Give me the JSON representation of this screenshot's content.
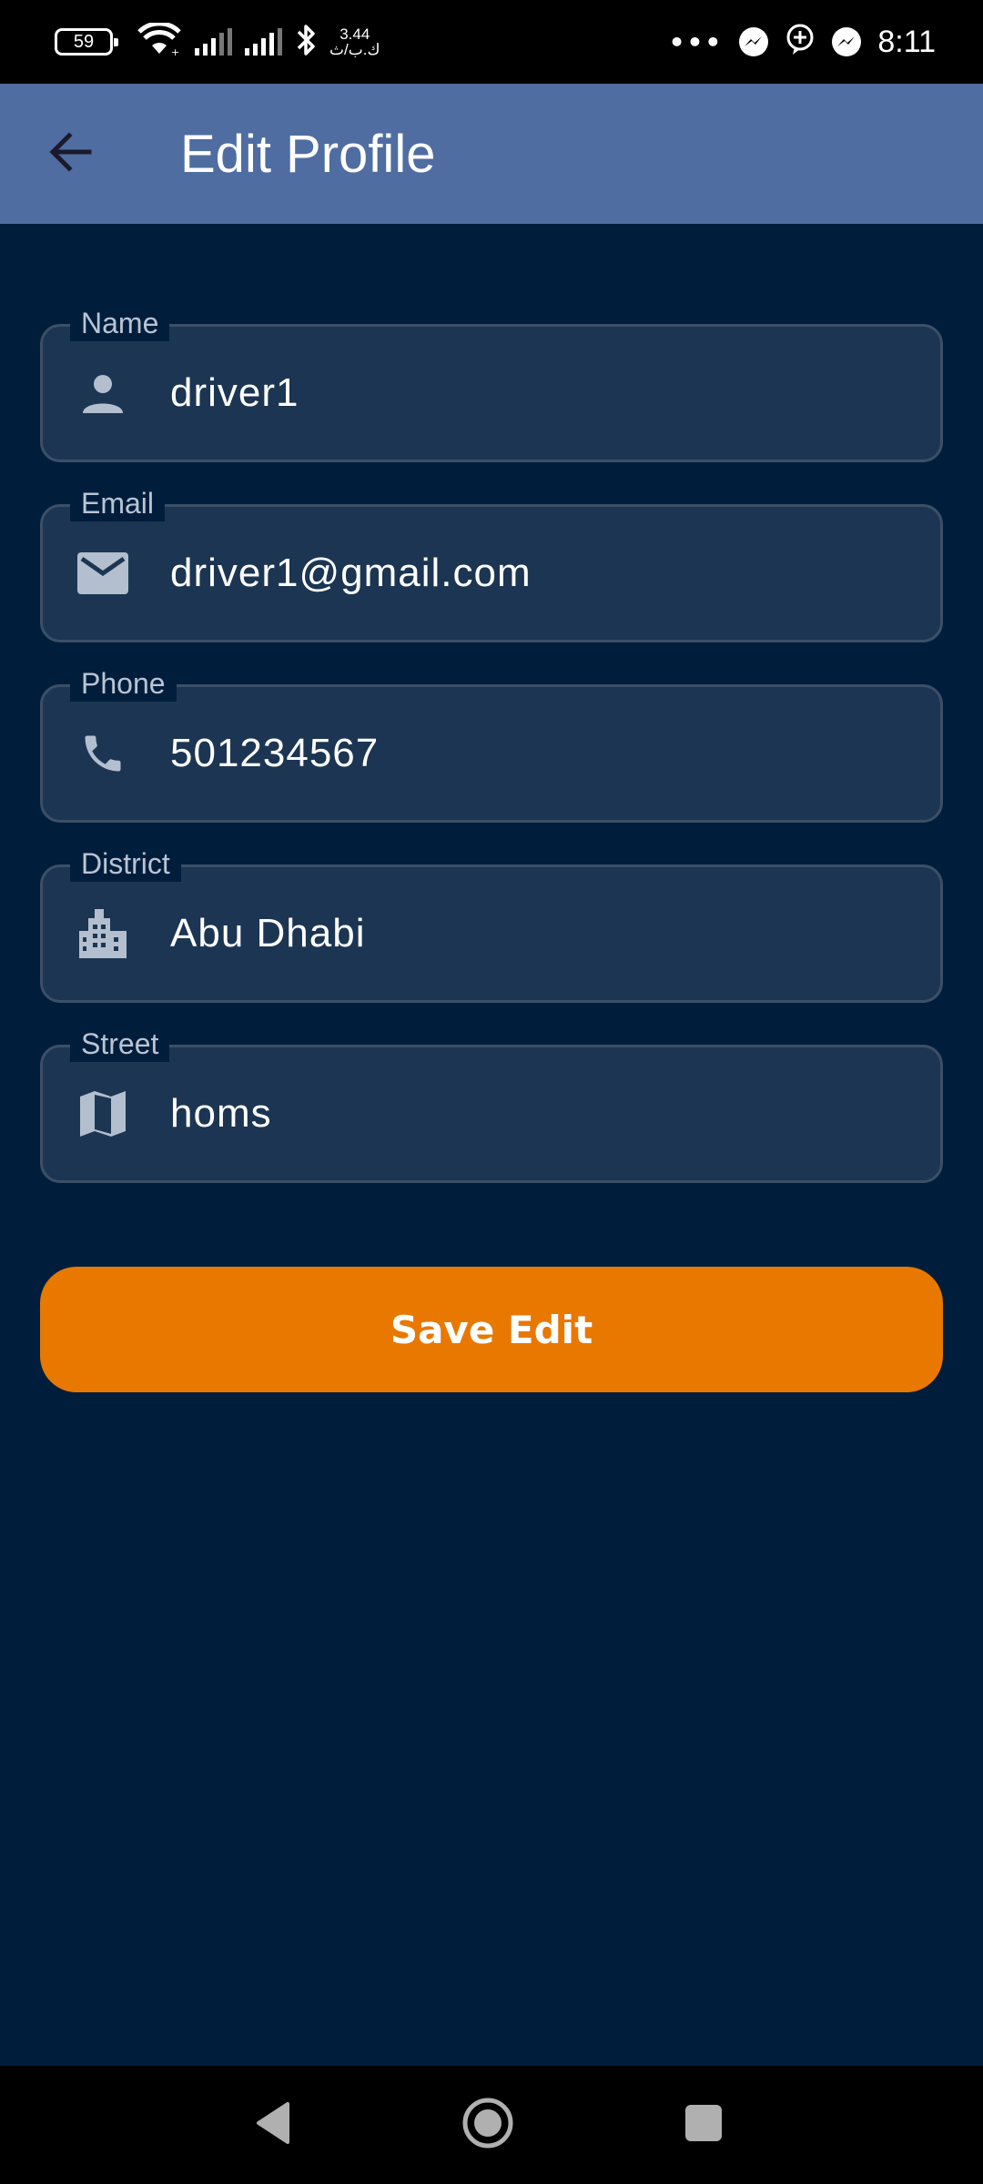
{
  "status_bar": {
    "battery": "59",
    "net_speed_value": "3.44",
    "net_speed_unit": "ك.ب/ث",
    "dots": "•••",
    "time": "8:11"
  },
  "app_bar": {
    "title": "Edit Profile",
    "back_icon": "arrow-back-icon"
  },
  "form": {
    "fields": [
      {
        "label": "Name",
        "value": "driver1",
        "icon": "person-icon"
      },
      {
        "label": "Email",
        "value": "driver1@gmail.com",
        "icon": "mail-icon"
      },
      {
        "label": "Phone",
        "value": "501234567",
        "icon": "phone-icon"
      },
      {
        "label": "District",
        "value": "Abu Dhabi",
        "icon": "building-icon"
      },
      {
        "label": "Street",
        "value": "homs",
        "icon": "map-icon"
      }
    ],
    "save_label": "Save Edit"
  },
  "colors": {
    "background": "#001e3c",
    "app_bar": "#4f6da1",
    "field_fill": "#1c3552",
    "accent": "#e87800"
  }
}
